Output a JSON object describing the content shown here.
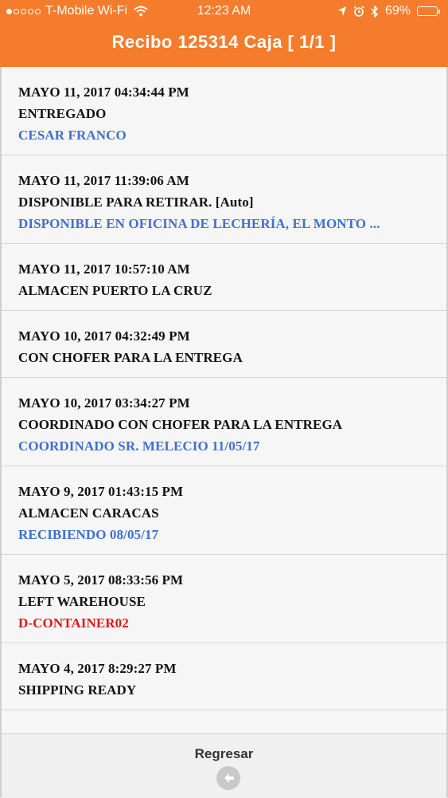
{
  "status_bar": {
    "carrier": "T-Mobile Wi-Fi",
    "time": "12:23 AM",
    "battery": "69%",
    "battery_level": 0.69,
    "signal_bars": 1
  },
  "header": {
    "title": "Recibo 125314 Caja [ 1/1 ]",
    "color": "#f47c2c"
  },
  "events": [
    {
      "date": "MAYO 11, 2017 04:34:44 PM",
      "status": "ENTREGADO",
      "detail": "CESAR FRANCO",
      "detail_color": "blue"
    },
    {
      "date": "MAYO 11, 2017 11:39:06 AM",
      "status": "DISPONIBLE PARA RETIRAR. [Auto]",
      "detail": "DISPONIBLE EN OFICINA DE LECHERÍA, EL MONTO ...",
      "detail_color": "blue"
    },
    {
      "date": "MAYO 11, 2017 10:57:10 AM",
      "status": "ALMACEN PUERTO LA CRUZ",
      "detail": "",
      "detail_color": ""
    },
    {
      "date": "MAYO 10, 2017 04:32:49 PM",
      "status": "CON CHOFER PARA LA ENTREGA",
      "detail": "",
      "detail_color": ""
    },
    {
      "date": "MAYO 10, 2017 03:34:27 PM",
      "status": "COORDINADO CON CHOFER PARA LA ENTREGA",
      "detail": "COORDINADO SR. MELECIO 11/05/17",
      "detail_color": "blue"
    },
    {
      "date": "MAYO 9, 2017 01:43:15 PM",
      "status": "ALMACEN CARACAS",
      "detail": "RECIBIENDO 08/05/17",
      "detail_color": "blue"
    },
    {
      "date": "MAYO 5, 2017 08:33:56 PM",
      "status": "LEFT WAREHOUSE",
      "detail": "D-CONTAINER02",
      "detail_color": "red"
    },
    {
      "date": "MAYO 4, 2017 8:29:27 PM",
      "status": "SHIPPING READY",
      "detail": "",
      "detail_color": ""
    }
  ],
  "footer": {
    "back_label": "Regresar",
    "back_icon": "arrow-left-icon"
  }
}
